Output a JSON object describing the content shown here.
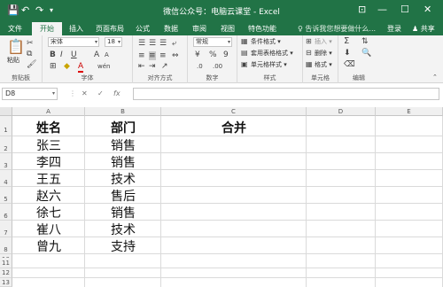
{
  "title": "微信公众号：电脑云课堂 - Excel",
  "quick_access": {
    "save": "💾",
    "undo": "↶",
    "redo": "↷",
    "customize": "▾"
  },
  "window_controls": {
    "ribbon_options": "⊡",
    "minimize": "—",
    "maximize": "☐",
    "close": "✕"
  },
  "tabs": [
    "文件",
    "开始",
    "插入",
    "页面布局",
    "公式",
    "数据",
    "审阅",
    "视图",
    "特色功能"
  ],
  "active_tab": "开始",
  "tell_me": "♀ 告诉我您想要做什么...",
  "login": "登录",
  "share": "♟ 共享",
  "ribbon": {
    "clipboard": {
      "label": "剪贴板",
      "paste": "粘贴"
    },
    "font": {
      "label": "字体",
      "font_name": "宋体",
      "font_size": "18",
      "bold": "B",
      "italic": "I",
      "underline": "U",
      "grow": "A",
      "shrink": "A",
      "wen": "wén"
    },
    "alignment": {
      "label": "对齐方式"
    },
    "number": {
      "label": "数字",
      "format": "常规",
      "percent": "%",
      "comma": "9"
    },
    "styles": {
      "label": "样式",
      "conditional": "条件格式 ▾",
      "table": "套用表格格式 ▾",
      "cell": "单元格样式 ▾"
    },
    "cells": {
      "label": "单元格",
      "insert": "插入 ▾",
      "delete": "删除 ▾",
      "format": "格式 ▾"
    },
    "editing": {
      "label": "编辑"
    }
  },
  "name_box": "D8",
  "formula_icons": {
    "cancel": "✕",
    "enter": "✓",
    "fx": "fx"
  },
  "columns": [
    "A",
    "B",
    "C",
    "D",
    "E"
  ],
  "rows": [
    "1",
    "2",
    "3",
    "4",
    "5",
    "6",
    "7",
    "8",
    "9",
    "10",
    "11",
    "12",
    "13"
  ],
  "cells": {
    "A1": "姓名",
    "B1": "部门",
    "C1": "合并",
    "A2": "张三",
    "B2": "销售",
    "A3": "李四",
    "B3": "销售",
    "A4": "王五",
    "B4": "技术",
    "A5": "赵六",
    "B5": "售后",
    "A6": "徐七",
    "B6": "销售",
    "A7": "崔八",
    "B7": "技术",
    "A8": "曾九",
    "B8": "支持"
  },
  "colors": {
    "accent": "#217346"
  }
}
